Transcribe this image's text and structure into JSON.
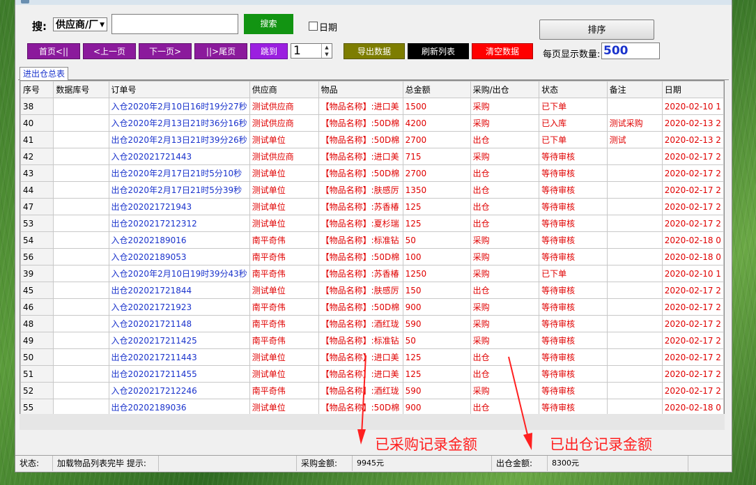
{
  "search": {
    "label": "搜:",
    "field_value": "供应商/厂",
    "input_value": "",
    "button": "搜索"
  },
  "date_filter": {
    "label": "日期",
    "checked": false
  },
  "sort_button": "排序",
  "nav": {
    "first": "首页<||",
    "prev": "<上一页",
    "next": "下一页>",
    "last": "||>尾页",
    "jump": "跳到",
    "page": "1"
  },
  "actions": {
    "export": "导出数据",
    "refresh": "刷新列表",
    "clear": "清空数据"
  },
  "per_page": {
    "label": "每页显示数量:",
    "value": "500"
  },
  "tab": "进出仓总表",
  "columns": [
    "序号",
    "数据库号",
    "订单号",
    "供应商",
    "物品",
    "总金额",
    "采购/出仓",
    "状态",
    "备注",
    "日期"
  ],
  "rows": [
    [
      "38",
      "",
      "入仓2020年2月10日16时19分27秒",
      "测试供应商",
      "【物品名称】:进口美",
      "1500",
      "采购",
      "已下单",
      "",
      "2020-02-10 1"
    ],
    [
      "40",
      "",
      "入仓2020年2月13日21时36分16秒",
      "测试供应商",
      "【物品名称】:50D棉",
      "4200",
      "采购",
      "已入库",
      "测试采购",
      "2020-02-13 2"
    ],
    [
      "41",
      "",
      "出仓2020年2月13日21时39分26秒",
      "测试单位",
      "【物品名称】:50D棉",
      "2700",
      "出仓",
      "已下单",
      "测试",
      "2020-02-13 2"
    ],
    [
      "42",
      "",
      "入仓202021721443",
      "测试供应商",
      "【物品名称】:进口美",
      "715",
      "采购",
      "等待审核",
      "",
      "2020-02-17 2"
    ],
    [
      "43",
      "",
      "出仓2020年2月17日21时5分10秒",
      "测试单位",
      "【物品名称】:50D棉",
      "2700",
      "出仓",
      "等待审核",
      "",
      "2020-02-17 2"
    ],
    [
      "44",
      "",
      "出仓2020年2月17日21时5分39秒",
      "测试单位",
      "【物品名称】:肤感厉",
      "1350",
      "出仓",
      "等待审核",
      "",
      "2020-02-17 2"
    ],
    [
      "47",
      "",
      "出仓202021721943",
      "测试单位",
      "【物品名称】:苏香椿",
      "125",
      "出仓",
      "等待审核",
      "",
      "2020-02-17 2"
    ],
    [
      "53",
      "",
      "出仓2020217212312",
      "测试单位",
      "【物品名称】:夏杉瑞",
      "125",
      "出仓",
      "等待审核",
      "",
      "2020-02-17 2"
    ],
    [
      "54",
      "",
      "入仓20202189016",
      "南平奇伟",
      "【物品名称】:标准钻",
      "50",
      "采购",
      "等待审核",
      "",
      "2020-02-18 0"
    ],
    [
      "56",
      "",
      "入仓20202189053",
      "南平奇伟",
      "【物品名称】:50D棉",
      "100",
      "采购",
      "等待审核",
      "",
      "2020-02-18 0"
    ],
    [
      "39",
      "",
      "入仓2020年2月10日19时39分43秒",
      "南平奇伟",
      "【物品名称】:苏香椿",
      "1250",
      "采购",
      "已下单",
      "",
      "2020-02-10 1"
    ],
    [
      "45",
      "",
      "出仓202021721844",
      "测试单位",
      "【物品名称】:肤感厉",
      "150",
      "出仓",
      "等待审核",
      "",
      "2020-02-17 2"
    ],
    [
      "46",
      "",
      "入仓202021721923",
      "南平奇伟",
      "【物品名称】:50D棉",
      "900",
      "采购",
      "等待审核",
      "",
      "2020-02-17 2"
    ],
    [
      "48",
      "",
      "入仓202021721148",
      "南平奇伟",
      "【物品名称】:酒红珑",
      "590",
      "采购",
      "等待审核",
      "",
      "2020-02-17 2"
    ],
    [
      "49",
      "",
      "入仓2020217211425",
      "南平奇伟",
      "【物品名称】:标准钻",
      "50",
      "采购",
      "等待审核",
      "",
      "2020-02-17 2"
    ],
    [
      "50",
      "",
      "出仓2020217211443",
      "测试单位",
      "【物品名称】:进口美",
      "125",
      "出仓",
      "等待审核",
      "",
      "2020-02-17 2"
    ],
    [
      "51",
      "",
      "出仓2020217211455",
      "测试单位",
      "【物品名称】:进口美",
      "125",
      "出仓",
      "等待审核",
      "",
      "2020-02-17 2"
    ],
    [
      "52",
      "",
      "入仓2020217212246",
      "南平奇伟",
      "【物品名称】:酒红珑",
      "590",
      "采购",
      "等待审核",
      "",
      "2020-02-17 2"
    ],
    [
      "55",
      "",
      "出仓20202189036",
      "测试单位",
      "【物品名称】:50D棉",
      "900",
      "出仓",
      "等待审核",
      "",
      "2020-02-18 0"
    ]
  ],
  "annotations": {
    "purchase": "已采购记录金额",
    "outbound": "已出仓记录金额"
  },
  "status": {
    "label": "状态:",
    "message": "加载物品列表完毕 提示:",
    "purchase_label": "采购金额:",
    "purchase_value": "9945元",
    "outbound_label": "出仓金额:",
    "outbound_value": "8300元"
  },
  "colors": {
    "accent_red": "#e00000",
    "link_blue": "#1a33cc",
    "nav_purple": "#8b1a9c",
    "search_green": "#129412",
    "export_olive": "#7d7d00",
    "refresh_black": "#000000",
    "clear_red": "#ff0000"
  }
}
